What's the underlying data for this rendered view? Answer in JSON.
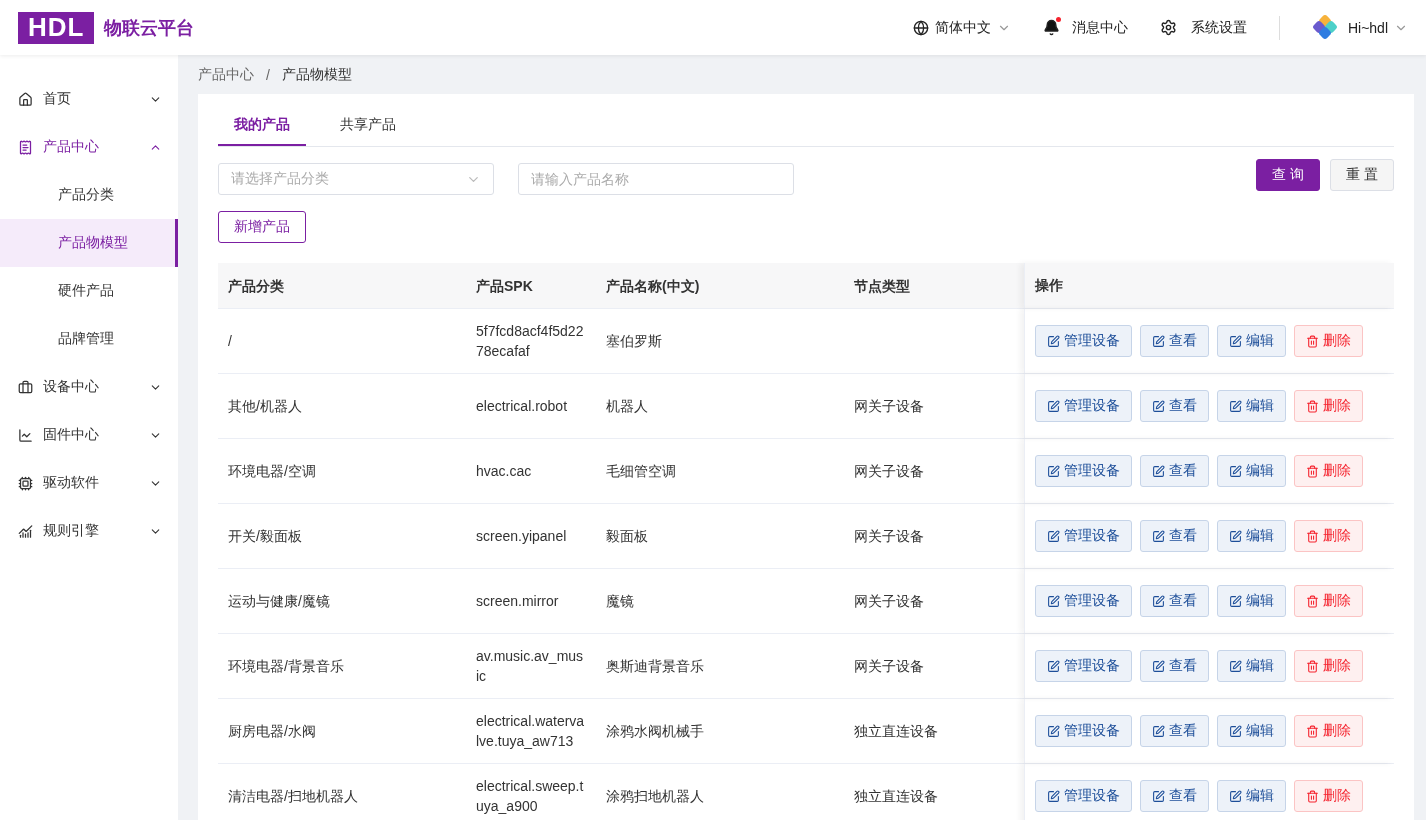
{
  "header": {
    "logo": "HDL",
    "platform": "物联云平台",
    "language": "简体中文",
    "messages": {
      "label": "消息中心",
      "unread": true
    },
    "settings": "系统设置",
    "user": "Hi~hdl"
  },
  "sidebar": {
    "items": [
      {
        "label": "首页",
        "expanded": false,
        "selected": false
      },
      {
        "label": "产品中心",
        "expanded": true,
        "selected": true,
        "children": [
          {
            "label": "产品分类",
            "selected": false
          },
          {
            "label": "产品物模型",
            "selected": true
          },
          {
            "label": "硬件产品",
            "selected": false
          },
          {
            "label": "品牌管理",
            "selected": false
          }
        ]
      },
      {
        "label": "设备中心",
        "expanded": false,
        "selected": false
      },
      {
        "label": "固件中心",
        "expanded": false,
        "selected": false
      },
      {
        "label": "驱动软件",
        "expanded": false,
        "selected": false
      },
      {
        "label": "规则引擎",
        "expanded": false,
        "selected": false
      }
    ]
  },
  "breadcrumb": {
    "items": [
      "产品中心",
      "产品物模型"
    ],
    "separator": "/"
  },
  "tabs": [
    {
      "label": "我的产品",
      "selected": true
    },
    {
      "label": "共享产品",
      "selected": false
    }
  ],
  "filters": {
    "category": {
      "placeholder": "请选择产品分类"
    },
    "name": {
      "placeholder": "请输入产品名称"
    },
    "query": "查 询",
    "reset": "重 置"
  },
  "add_button": "新增产品",
  "table": {
    "columns": [
      "产品分类",
      "产品SPK",
      "产品名称(中文)",
      "节点类型",
      "操作"
    ],
    "rows": [
      {
        "category": "/",
        "spk": "5f7fcd8acf4f5d2278ecafaf",
        "name": "塞伯罗斯",
        "node": "",
        "actions": [
          {
            "label": "管理设备",
            "kind": "edit"
          },
          {
            "label": "查看",
            "kind": "edit"
          },
          {
            "label": "编辑",
            "kind": "edit"
          },
          {
            "label": "删除",
            "kind": "delete"
          }
        ]
      },
      {
        "category": "其他/机器人",
        "spk": "electrical.robot",
        "name": "机器人",
        "node": "网关子设备",
        "actions": [
          {
            "label": "管理设备",
            "kind": "edit"
          },
          {
            "label": "查看",
            "kind": "edit"
          },
          {
            "label": "编辑",
            "kind": "edit"
          },
          {
            "label": "删除",
            "kind": "delete"
          }
        ]
      },
      {
        "category": "环境电器/空调",
        "spk": "hvac.cac",
        "name": "毛细管空调",
        "node": "网关子设备",
        "actions": [
          {
            "label": "管理设备",
            "kind": "edit"
          },
          {
            "label": "查看",
            "kind": "edit"
          },
          {
            "label": "编辑",
            "kind": "edit"
          },
          {
            "label": "删除",
            "kind": "delete"
          }
        ]
      },
      {
        "category": "开关/毅面板",
        "spk": "screen.yipanel",
        "name": "毅面板",
        "node": "网关子设备",
        "actions": [
          {
            "label": "管理设备",
            "kind": "edit"
          },
          {
            "label": "查看",
            "kind": "edit"
          },
          {
            "label": "编辑",
            "kind": "edit"
          },
          {
            "label": "删除",
            "kind": "delete"
          }
        ]
      },
      {
        "category": "运动与健康/魔镜",
        "spk": "screen.mirror",
        "name": "魔镜",
        "node": "网关子设备",
        "actions": [
          {
            "label": "管理设备",
            "kind": "edit"
          },
          {
            "label": "查看",
            "kind": "edit"
          },
          {
            "label": "编辑",
            "kind": "edit"
          },
          {
            "label": "删除",
            "kind": "delete"
          }
        ]
      },
      {
        "category": "环境电器/背景音乐",
        "spk": "av.music.av_music",
        "name": "奥斯迪背景音乐",
        "node": "网关子设备",
        "actions": [
          {
            "label": "管理设备",
            "kind": "edit"
          },
          {
            "label": "查看",
            "kind": "edit"
          },
          {
            "label": "编辑",
            "kind": "edit"
          },
          {
            "label": "删除",
            "kind": "delete"
          }
        ]
      },
      {
        "category": "厨房电器/水阀",
        "spk": "electrical.watervalve.tuya_aw713",
        "name": "涂鸦水阀机械手",
        "node": "独立直连设备",
        "actions": [
          {
            "label": "管理设备",
            "kind": "edit"
          },
          {
            "label": "查看",
            "kind": "edit"
          },
          {
            "label": "编辑",
            "kind": "edit"
          },
          {
            "label": "删除",
            "kind": "delete"
          }
        ]
      },
      {
        "category": "清洁电器/扫地机器人",
        "spk": "electrical.sweep.tuya_a900",
        "name": "涂鸦扫地机器人",
        "node": "独立直连设备",
        "actions": [
          {
            "label": "管理设备",
            "kind": "edit"
          },
          {
            "label": "查看",
            "kind": "edit"
          },
          {
            "label": "编辑",
            "kind": "edit"
          },
          {
            "label": "删除",
            "kind": "delete"
          }
        ]
      }
    ]
  }
}
